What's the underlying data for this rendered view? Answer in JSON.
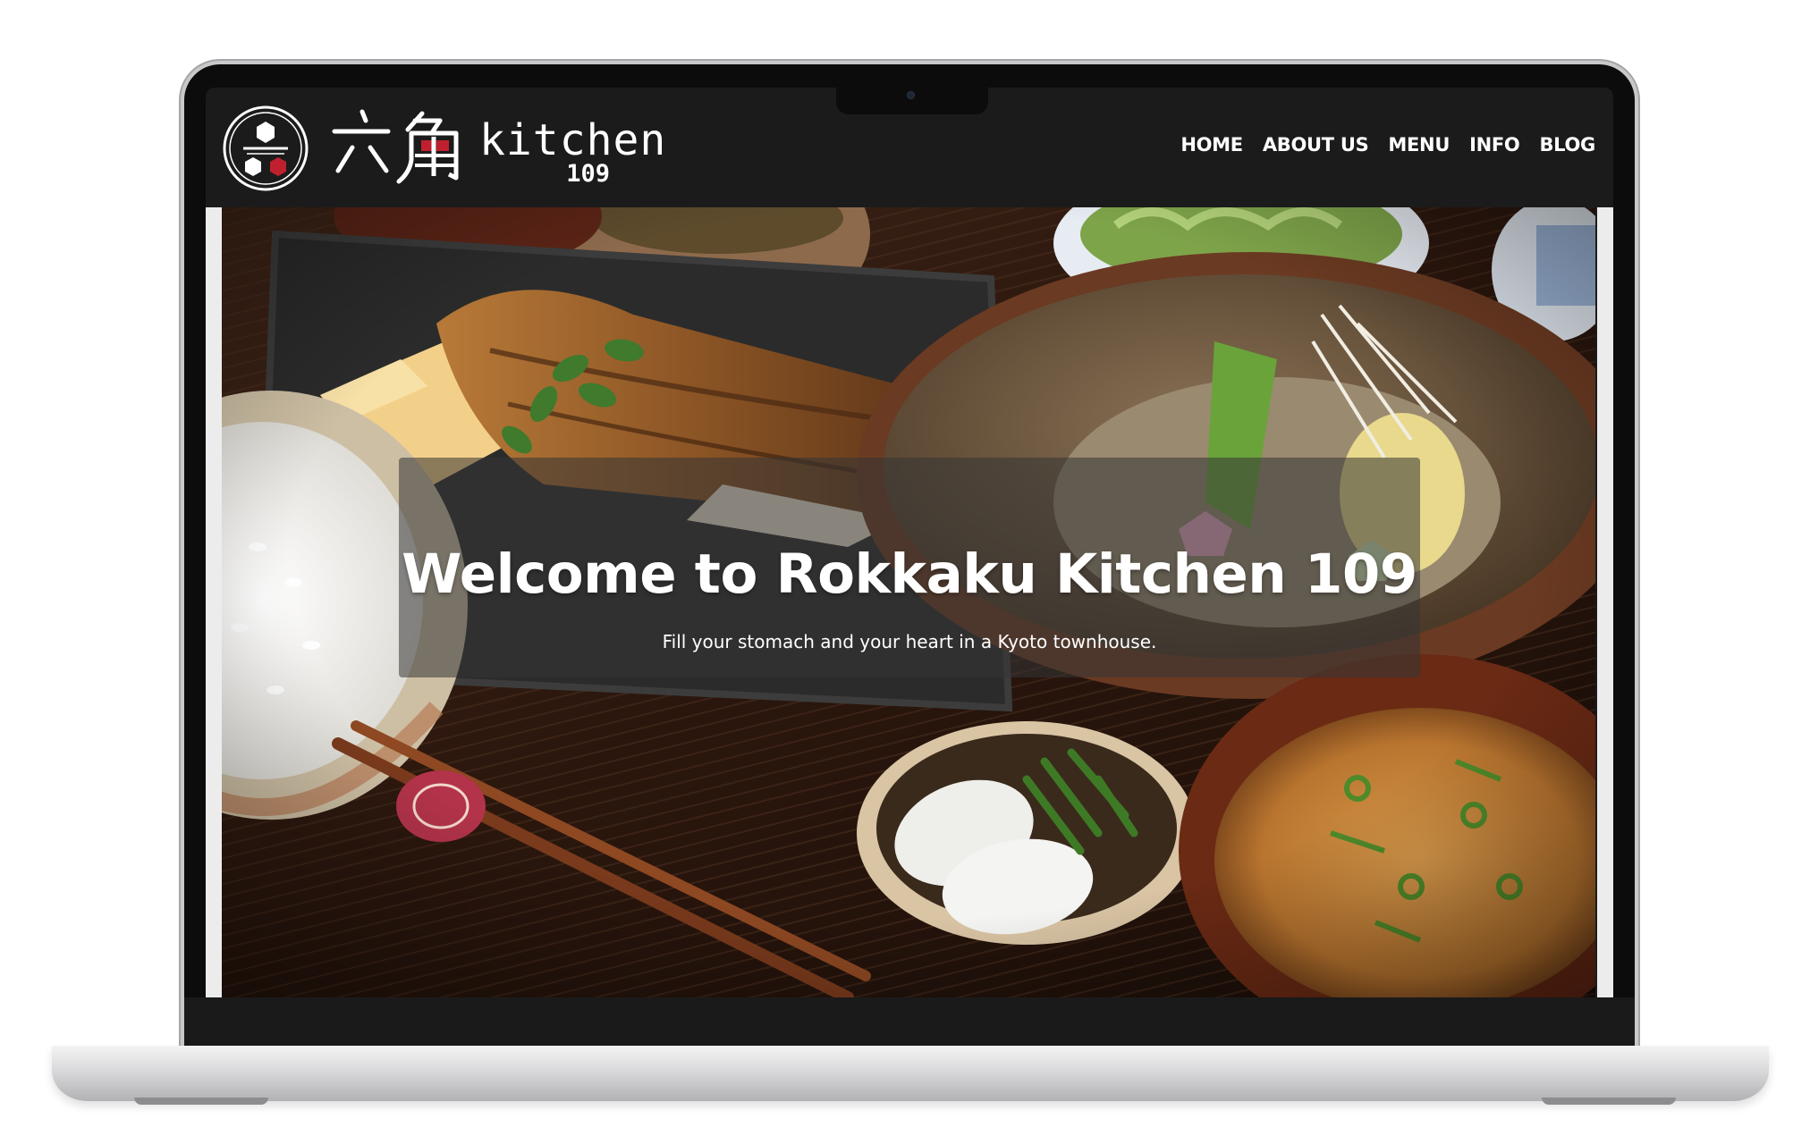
{
  "site": {
    "logo": {
      "kanji": "六角",
      "wordmark": "kitchen",
      "number": "109"
    },
    "nav": {
      "items": [
        {
          "label": "HOME"
        },
        {
          "label": "ABOUT US"
        },
        {
          "label": "MENU"
        },
        {
          "label": "INFO"
        },
        {
          "label": "BLOG"
        }
      ]
    },
    "hero": {
      "title": "Welcome to Rokkaku Kitchen 109",
      "subtitle": "Fill your stomach and your heart in a Kyoto townhouse."
    }
  },
  "colors": {
    "header_bg": "#1b1b1b",
    "logo_accent": "#c0202d",
    "text": "#ffffff"
  }
}
